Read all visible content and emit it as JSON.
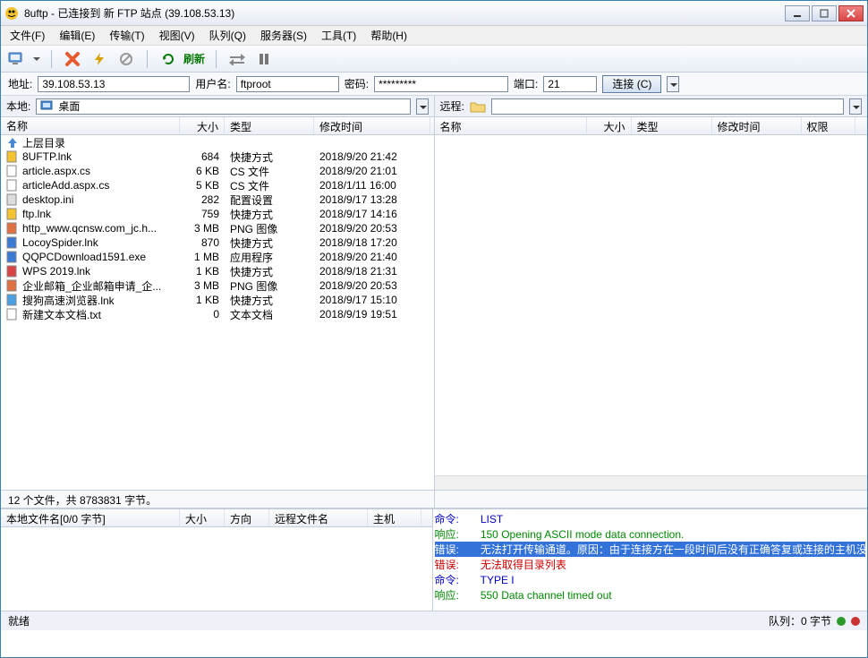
{
  "title": "8uftp - 已连接到 新 FTP 站点 (39.108.53.13)",
  "menu": [
    "文件(F)",
    "编辑(E)",
    "传输(T)",
    "视图(V)",
    "队列(Q)",
    "服务器(S)",
    "工具(T)",
    "帮助(H)"
  ],
  "toolbar": {
    "refresh": "刷新"
  },
  "conn": {
    "addr_label": "地址:",
    "addr": "39.108.53.13",
    "user_label": "用户名:",
    "user": "ftproot",
    "pass_label": "密码:",
    "pass": "*********",
    "port_label": "端口:",
    "port": "21",
    "connect": "连接 (C)"
  },
  "local": {
    "label": "本地:",
    "path": "桌面",
    "cols": {
      "name": "名称",
      "size": "大小",
      "type": "类型",
      "mtime": "修改时间"
    },
    "up": "上层目录",
    "files": [
      {
        "icon": "ftp",
        "name": "8UFTP.lnk",
        "size": "684",
        "type": "快捷方式",
        "mtime": "2018/9/20 21:42"
      },
      {
        "icon": "file",
        "name": "article.aspx.cs",
        "size": "6 KB",
        "type": "CS 文件",
        "mtime": "2018/9/20 21:01"
      },
      {
        "icon": "file",
        "name": "articleAdd.aspx.cs",
        "size": "5 KB",
        "type": "CS 文件",
        "mtime": "2018/1/11 16:00"
      },
      {
        "icon": "ini",
        "name": "desktop.ini",
        "size": "282",
        "type": "配置设置",
        "mtime": "2018/9/17 13:28"
      },
      {
        "icon": "ftp",
        "name": "ftp.lnk",
        "size": "759",
        "type": "快捷方式",
        "mtime": "2018/9/17 14:16"
      },
      {
        "icon": "png",
        "name": "http_www.qcnsw.com_jc.h...",
        "size": "3 MB",
        "type": "PNG 图像",
        "mtime": "2018/9/20 20:53"
      },
      {
        "icon": "shield",
        "name": "LocoySpider.lnk",
        "size": "870",
        "type": "快捷方式",
        "mtime": "2018/9/18 17:20"
      },
      {
        "icon": "shield",
        "name": "QQPCDownload1591.exe",
        "size": "1 MB",
        "type": "应用程序",
        "mtime": "2018/9/20 21:40"
      },
      {
        "icon": "wps",
        "name": "WPS 2019.lnk",
        "size": "1 KB",
        "type": "快捷方式",
        "mtime": "2018/9/18 21:31"
      },
      {
        "icon": "png",
        "name": "企业邮箱_企业邮箱申请_企...",
        "size": "3 MB",
        "type": "PNG 图像",
        "mtime": "2018/9/20 20:53"
      },
      {
        "icon": "sogou",
        "name": "搜狗高速浏览器.lnk",
        "size": "1 KB",
        "type": "快捷方式",
        "mtime": "2018/9/17 15:10"
      },
      {
        "icon": "txt",
        "name": "新建文本文档.txt",
        "size": "0",
        "type": "文本文档",
        "mtime": "2018/9/19 19:51"
      }
    ],
    "status": "12 个文件，共 8783831 字节。"
  },
  "remote": {
    "label": "远程:",
    "cols": {
      "name": "名称",
      "size": "大小",
      "type": "类型",
      "mtime": "修改时间",
      "perm": "权限"
    }
  },
  "queue": {
    "cols": {
      "name": "本地文件名[0/0 字节]",
      "size": "大小",
      "dir": "方向",
      "remote": "远程文件名",
      "host": "主机"
    }
  },
  "log": [
    {
      "cls": "cmd",
      "prefix": "命令:",
      "text": "LIST"
    },
    {
      "cls": "resp",
      "prefix": "响应:",
      "text": "150 Opening ASCII mode data connection."
    },
    {
      "cls": "sel",
      "prefix": "错误:",
      "text": "无法打开传输通道。原因：由于连接方在一段时间后没有正确答复或连接的主机没有反应，连接尝试失败。"
    },
    {
      "cls": "err",
      "prefix": "错误:",
      "text": "无法取得目录列表"
    },
    {
      "cls": "cmd",
      "prefix": "命令:",
      "text": "TYPE I"
    },
    {
      "cls": "resp",
      "prefix": "响应:",
      "text": "550 Data channel timed out"
    }
  ],
  "status": {
    "ready": "就绪",
    "queue": "队列：0 字节"
  }
}
